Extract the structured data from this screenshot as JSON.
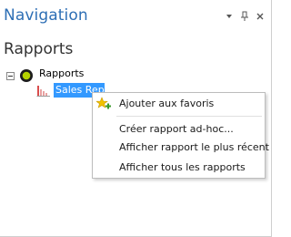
{
  "panel": {
    "title": "Navigation",
    "controls": [
      "dropdown-icon",
      "pin-icon",
      "close-icon"
    ]
  },
  "section": {
    "title": "Rapports"
  },
  "tree": {
    "root": {
      "label": "Rapports",
      "expanded": true,
      "icon": "status-circle-icon"
    },
    "children": [
      {
        "label": "Sales Report",
        "selected": true,
        "icon": "report-chart-icon"
      }
    ]
  },
  "context_menu": {
    "items": [
      {
        "label": "Ajouter aux favoris",
        "icon": "add-favorite-icon"
      },
      {
        "label": "Créer rapport ad-hoc..."
      },
      {
        "label": "Afficher rapport le plus récent"
      },
      {
        "label": "Afficher tous les rapports"
      }
    ]
  },
  "colors": {
    "title": "#2e6fb5",
    "selection": "#3399ff",
    "status_outer": "#1d1d1d",
    "status_inner": "#b5d300",
    "star": "#f2c200",
    "plus": "#3b9a2a"
  }
}
